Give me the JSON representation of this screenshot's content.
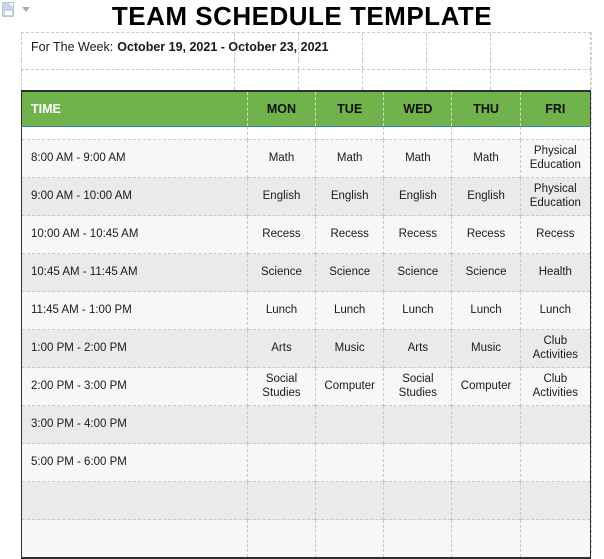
{
  "document": {
    "title": "TEAM SCHEDULE TEMPLATE"
  },
  "week": {
    "label": "For The Week:",
    "value": "October 19, 2021 - October 23, 2021"
  },
  "toolbar": {
    "paste_icon": "paste-options-icon",
    "dropdown_icon": "chevron-down-icon"
  },
  "colors": {
    "header_green": "#70b24b",
    "header_time_text": "#ffffff",
    "header_day_text": "#111111",
    "row_light": "#f7f7f7",
    "row_shaded": "#eaeaea",
    "table_border": "#2f2f2f",
    "grid_dashed": "#c9c9c9"
  },
  "table": {
    "columns": [
      "TIME",
      "MON",
      "TUE",
      "WED",
      "THU",
      "FRI"
    ],
    "rows": [
      {
        "time": "8:00 AM - 9:00 AM",
        "mon": "Math",
        "tue": "Math",
        "wed": "Math",
        "thu": "Math",
        "fri": "Physical Education"
      },
      {
        "time": "9:00 AM - 10:00 AM",
        "mon": "English",
        "tue": "English",
        "wed": "English",
        "thu": "English",
        "fri": "Physical Education"
      },
      {
        "time": "10:00 AM - 10:45 AM",
        "mon": "Recess",
        "tue": "Recess",
        "wed": "Recess",
        "thu": "Recess",
        "fri": "Recess"
      },
      {
        "time": "10:45 AM - 11:45 AM",
        "mon": "Science",
        "tue": "Science",
        "wed": "Science",
        "thu": "Science",
        "fri": "Health"
      },
      {
        "time": "11:45 AM - 1:00 PM",
        "mon": "Lunch",
        "tue": "Lunch",
        "wed": "Lunch",
        "thu": "Lunch",
        "fri": "Lunch"
      },
      {
        "time": "1:00 PM - 2:00 PM",
        "mon": "Arts",
        "tue": "Music",
        "wed": "Arts",
        "thu": "Music",
        "fri": "Club Activities"
      },
      {
        "time": "2:00 PM - 3:00 PM",
        "mon": "Social Studies",
        "tue": "Computer",
        "wed": "Social Studies",
        "thu": "Computer",
        "fri": "Club Activities"
      },
      {
        "time": "3:00 PM - 4:00 PM",
        "mon": "",
        "tue": "",
        "wed": "",
        "thu": "",
        "fri": ""
      },
      {
        "time": "5:00 PM - 6:00 PM",
        "mon": "",
        "tue": "",
        "wed": "",
        "thu": "",
        "fri": ""
      },
      {
        "time": "",
        "mon": "",
        "tue": "",
        "wed": "",
        "thu": "",
        "fri": ""
      },
      {
        "time": "",
        "mon": "",
        "tue": "",
        "wed": "",
        "thu": "",
        "fri": ""
      }
    ]
  }
}
